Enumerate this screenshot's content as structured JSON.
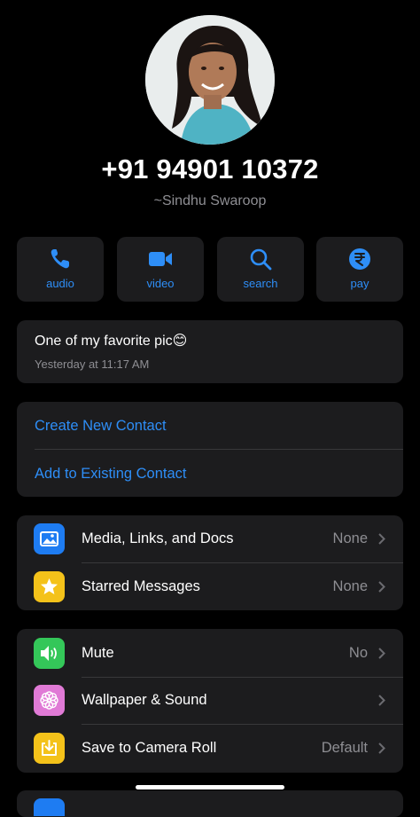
{
  "contact": {
    "phone": "+91 94901 10372",
    "push_name": "~Sindhu Swaroop"
  },
  "actions": [
    {
      "label": "audio",
      "icon": "phone-icon"
    },
    {
      "label": "video",
      "icon": "video-camera-icon"
    },
    {
      "label": "search",
      "icon": "magnifier-icon"
    },
    {
      "label": "pay",
      "icon": "rupee-icon"
    }
  ],
  "about": {
    "text": "One of my favorite pic😊",
    "timestamp": "Yesterday at 11:17 AM"
  },
  "contact_options": {
    "create": "Create New Contact",
    "add_existing": "Add to Existing Contact"
  },
  "media_section": [
    {
      "title": "Media, Links, and Docs",
      "value": "None",
      "icon": "photo-icon",
      "color": "#1e7cf2"
    },
    {
      "title": "Starred Messages",
      "value": "None",
      "icon": "star-icon",
      "color": "#f4c21a"
    }
  ],
  "settings_section": [
    {
      "title": "Mute",
      "value": "No",
      "icon": "speaker-icon",
      "color": "#34c759"
    },
    {
      "title": "Wallpaper & Sound",
      "value": "",
      "icon": "flower-icon",
      "color": "#e07ad6"
    },
    {
      "title": "Save to Camera Roll",
      "value": "Default",
      "icon": "download-icon",
      "color": "#f4c21a"
    }
  ],
  "theme": {
    "accent": "#2e8ef7",
    "background": "#000000",
    "card": "#1c1c1e"
  }
}
